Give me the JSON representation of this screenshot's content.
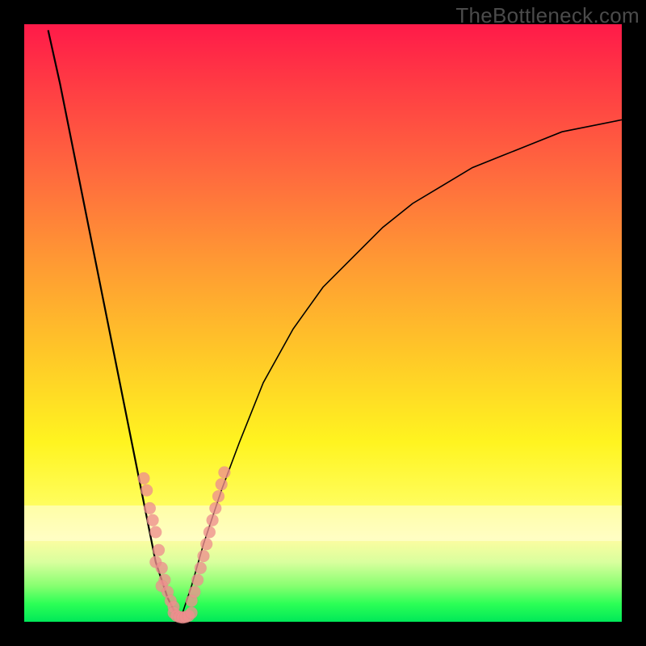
{
  "site_label": "TheBottleneck.com",
  "colors": {
    "gradient_top": "#ff1a49",
    "gradient_mid1": "#ff9a33",
    "gradient_mid2": "#fff420",
    "gradient_bottom": "#00e858",
    "dot": "#ef8f8f",
    "curve": "#000000",
    "frame": "#000000"
  },
  "chart_data": {
    "type": "line",
    "title": "",
    "xlabel": "",
    "ylabel": "",
    "xlim": [
      0,
      100
    ],
    "ylim": [
      0,
      100
    ],
    "grid": false,
    "legend": false,
    "series": [
      {
        "name": "left-curve",
        "x": [
          4,
          6,
          8,
          10,
          12,
          14,
          16,
          18,
          20,
          21,
          22,
          23,
          24,
          25,
          26
        ],
        "y": [
          99,
          90,
          80,
          70,
          60,
          50,
          40,
          30,
          20,
          15,
          10,
          7,
          4,
          2,
          0
        ]
      },
      {
        "name": "right-curve",
        "x": [
          26,
          28,
          30,
          33,
          36,
          40,
          45,
          50,
          55,
          60,
          65,
          70,
          75,
          80,
          85,
          90,
          95,
          100
        ],
        "y": [
          0,
          6,
          13,
          22,
          30,
          40,
          49,
          56,
          61,
          66,
          70,
          73,
          76,
          78,
          80,
          82,
          83,
          84
        ]
      }
    ],
    "scatter": {
      "name": "highlight-dots",
      "points": [
        {
          "x": 20,
          "y": 24
        },
        {
          "x": 20.5,
          "y": 22
        },
        {
          "x": 21,
          "y": 19
        },
        {
          "x": 21.5,
          "y": 17
        },
        {
          "x": 22,
          "y": 15
        },
        {
          "x": 22.5,
          "y": 12
        },
        {
          "x": 22,
          "y": 10
        },
        {
          "x": 23,
          "y": 9
        },
        {
          "x": 23.5,
          "y": 7
        },
        {
          "x": 23,
          "y": 6
        },
        {
          "x": 24,
          "y": 5
        },
        {
          "x": 24.5,
          "y": 3.5
        },
        {
          "x": 25,
          "y": 2.5
        },
        {
          "x": 25,
          "y": 1.5
        },
        {
          "x": 25.5,
          "y": 1
        },
        {
          "x": 26,
          "y": 0.8
        },
        {
          "x": 26.5,
          "y": 0.7
        },
        {
          "x": 27,
          "y": 0.8
        },
        {
          "x": 27.5,
          "y": 1
        },
        {
          "x": 28,
          "y": 1.5
        },
        {
          "x": 28,
          "y": 3.5
        },
        {
          "x": 28.5,
          "y": 5
        },
        {
          "x": 29,
          "y": 7
        },
        {
          "x": 29.5,
          "y": 9
        },
        {
          "x": 30,
          "y": 11
        },
        {
          "x": 30.5,
          "y": 13
        },
        {
          "x": 31,
          "y": 15
        },
        {
          "x": 31.5,
          "y": 17
        },
        {
          "x": 32,
          "y": 19
        },
        {
          "x": 32.5,
          "y": 21
        },
        {
          "x": 33,
          "y": 23
        },
        {
          "x": 33.5,
          "y": 25
        }
      ]
    }
  }
}
